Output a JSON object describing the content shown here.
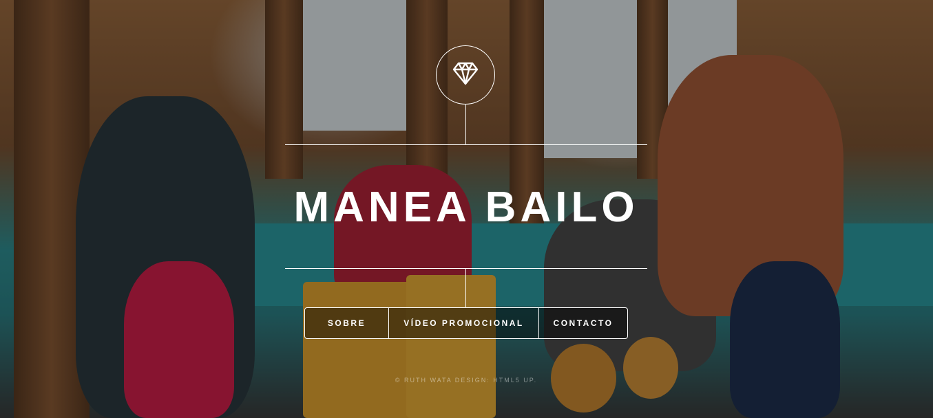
{
  "header": {
    "logo_icon": "diamond-icon",
    "title": "MANEA BAILO"
  },
  "nav": {
    "items": [
      {
        "label": "SOBRE"
      },
      {
        "label": "VÍDEO PROMOCIONAL"
      },
      {
        "label": "CONTACTO"
      }
    ]
  },
  "footer": {
    "text": "© RUTH WATA DESIGN: HTML5 UP."
  }
}
